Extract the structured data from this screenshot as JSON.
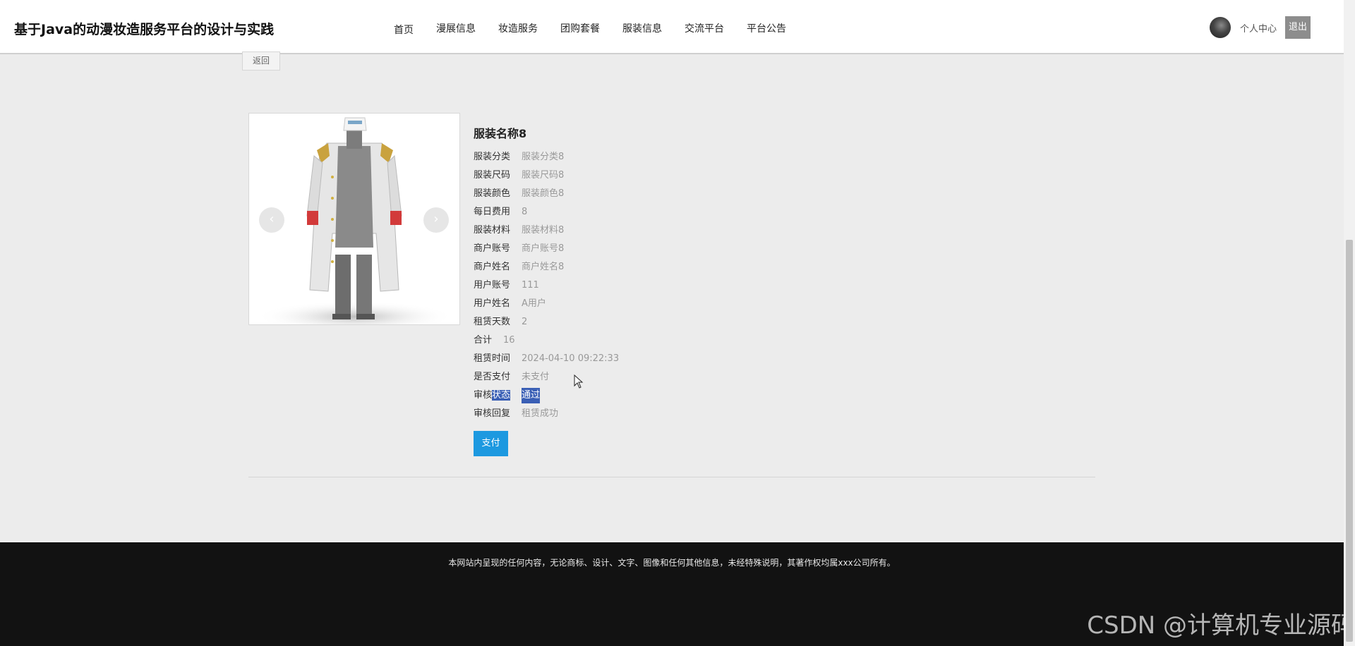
{
  "header": {
    "site_title": "基于Java的动漫妆造服务平台的设计与实践",
    "nav": [
      "首页",
      "漫展信息",
      "妆造服务",
      "团购套餐",
      "服装信息",
      "交流平台",
      "平台公告"
    ],
    "personal_center": "个人中心",
    "logout": "退出"
  },
  "back_label": "返回",
  "carousel": {
    "prev": "‹",
    "next": "›"
  },
  "detail": {
    "title": "服装名称8",
    "rows": [
      {
        "label": "服装分类",
        "value": "服装分类8"
      },
      {
        "label": "服装尺码",
        "value": "服装尺码8"
      },
      {
        "label": "服装颜色",
        "value": "服装颜色8"
      },
      {
        "label": "每日费用",
        "value": "8"
      },
      {
        "label": "服装材料",
        "value": "服装材料8"
      },
      {
        "label": "商户账号",
        "value": "商户账号8"
      },
      {
        "label": "商户姓名",
        "value": "商户姓名8"
      },
      {
        "label": "用户账号",
        "value": "111"
      },
      {
        "label": "用户姓名",
        "value": "A用户"
      },
      {
        "label": "租赁天数",
        "value": "2"
      },
      {
        "label": "合计",
        "value": "16"
      },
      {
        "label": "租赁时间",
        "value": "2024-04-10 09:22:33"
      },
      {
        "label": "是否支付",
        "value": "未支付"
      },
      {
        "label_prefix": "审核",
        "label_highlight": "状态",
        "value": "通过"
      },
      {
        "label": "审核回复",
        "value": "租赁成功"
      }
    ],
    "pay_label": "支付"
  },
  "footer": {
    "copyright": "本网站内呈现的任何内容，无论商标、设计、文字、图像和任何其他信息，未经特殊说明，其著作权均属xxx公司所有。"
  },
  "watermark": "CSDN @计算机专业源码",
  "colors": {
    "pay_button": "#1d99e0",
    "highlight": "#3a5fb5",
    "footer_bg": "#121212"
  }
}
